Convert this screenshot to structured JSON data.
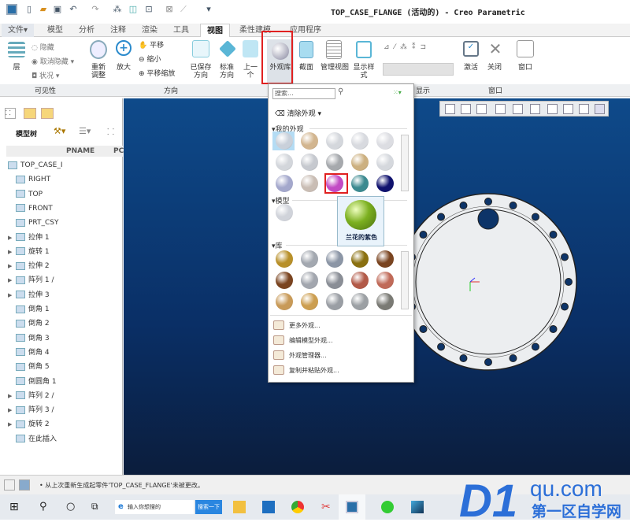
{
  "window": {
    "title": "TOP_CASE_FLANGE (活动的) - Creo Parametric"
  },
  "tabs": [
    {
      "label": "文件▾"
    },
    {
      "label": "模型"
    },
    {
      "label": "分析"
    },
    {
      "label": "注释"
    },
    {
      "label": "渲染"
    },
    {
      "label": "工具"
    },
    {
      "label": "视图",
      "active": true
    },
    {
      "label": "柔性建模"
    },
    {
      "label": "应用程序"
    }
  ],
  "ribbon": {
    "visibility": {
      "layers": "层",
      "hide": "隐藏",
      "unhide": "取消隐藏",
      "status": "状况",
      "group": "可见性"
    },
    "orientation": {
      "refit": "重新调整",
      "zoom_in": "放大",
      "pan": "平移",
      "zoom_out": "缩小",
      "pan_zoom": "平移缩放",
      "saved": "已保存方向",
      "standard": "标准方向",
      "previous": "上一个",
      "group": "方向"
    },
    "model_display": {
      "appearance_gallery": "外观库",
      "section": "截面",
      "manage_views": "管理视图",
      "display_style": "显示样式",
      "group": "显示"
    },
    "window": {
      "activate": "激活",
      "close": "关闭",
      "windows": "窗口",
      "group": "窗口"
    }
  },
  "model_tree": {
    "title": "模型树",
    "column": "PNAME",
    "column2": "PC",
    "items": [
      {
        "label": "TOP_CASE_I",
        "expand": false
      },
      {
        "label": "RIGHT"
      },
      {
        "label": "TOP"
      },
      {
        "label": "FRONT"
      },
      {
        "label": "PRT_CSY"
      },
      {
        "label": "拉伸 1",
        "expand": true
      },
      {
        "label": "旋转 1",
        "expand": true
      },
      {
        "label": "拉伸 2",
        "expand": true
      },
      {
        "label": "阵列 1 /",
        "expand": true
      },
      {
        "label": "拉伸 3",
        "expand": true
      },
      {
        "label": "倒角 1"
      },
      {
        "label": "倒角 2"
      },
      {
        "label": "倒角 3"
      },
      {
        "label": "倒角 4"
      },
      {
        "label": "倒角 5"
      },
      {
        "label": "倒圆角 1"
      },
      {
        "label": "阵列 2 /",
        "expand": true
      },
      {
        "label": "阵列 3 /",
        "expand": true
      },
      {
        "label": "旋转 2",
        "expand": true
      },
      {
        "label": "在此插入"
      }
    ]
  },
  "appearance_menu": {
    "search_placeholder": "搜索...",
    "clear": "清除外观",
    "my_appearances": "我的外观",
    "model": "模型",
    "library": "库",
    "my_colors": [
      "#c9d0da",
      "#d2b58f",
      "#d4d7dc",
      "#d8dadf",
      "#dcdde2",
      "#d3d6db",
      "#c6c9cf",
      "#a6a9ad",
      "#ccb080",
      "#d5d8dd",
      "#a4a8cc",
      "#c9bdb4",
      "#c24ac4",
      "#3c8a90",
      "#10126e"
    ],
    "model_colors": [
      "#d0d3da"
    ],
    "library_colors": [
      "#b8902a",
      "#a3a8b0",
      "#8c96a6",
      "#8a7010",
      "#7a4420",
      "#7a4420",
      "#a2a6ae",
      "#8a8e96",
      "#b25a48",
      "#c06a58",
      "#c89a58",
      "#cc9e50",
      "#9a9ea4",
      "#9ca0a4",
      "#7a7a74"
    ],
    "tooltip": {
      "label": "兰花的紫色",
      "color": "#7cb020"
    },
    "actions": [
      "更多外观...",
      "编辑模型外观...",
      "外观管理器...",
      "复制并粘贴外观..."
    ]
  },
  "status": {
    "message": "从上次重新生成起零件'TOP_CASE_FLANGE'未被更改。"
  },
  "taskbar": {
    "search_placeholder": "输入你想搜的",
    "search_button": "搜索一下"
  },
  "watermark": {
    "brand": "D1qu.com",
    "sub": "第一区自学网"
  }
}
